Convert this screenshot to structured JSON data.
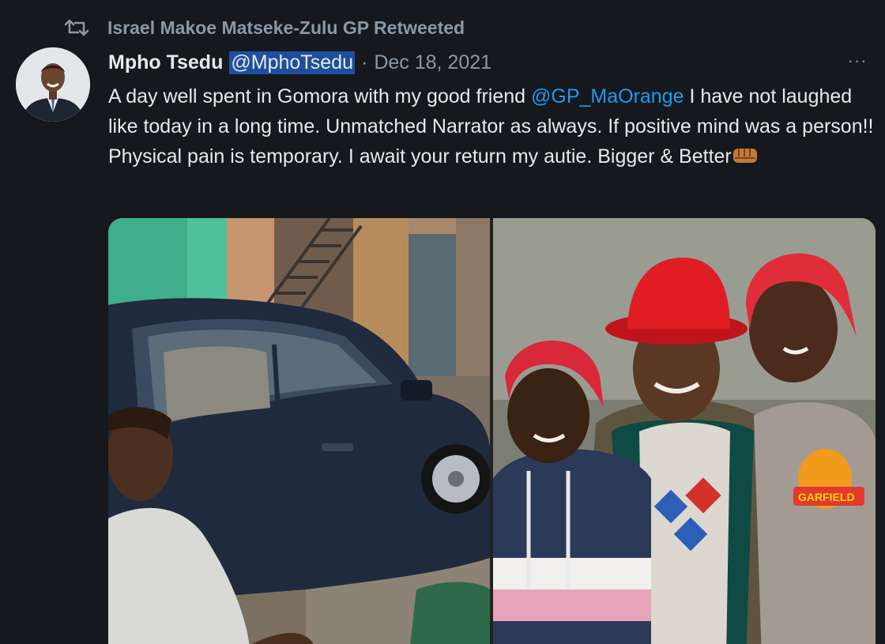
{
  "retweet": {
    "icon": "retweet-icon",
    "label": "Israel Makoe Matseke-Zulu GP Retweeted"
  },
  "author": {
    "name": "Mpho Tsedu",
    "handle": "@MphoTsedu",
    "separator": "·",
    "date": "Dec 18, 2021",
    "avatar_icon": "avatar"
  },
  "more_icon": "more-options-icon",
  "more_label": "···",
  "tweet": {
    "part1": "A day well spent in Gomora with my good friend ",
    "mention": "@GP_MaOrange",
    "part2": " I have not laughed like today in a long time. Unmatched Narrator as always. If positive mind was a person!! Physical pain is temporary. I await your return my autie. Bigger & Better",
    "emoji": "fist-bump-icon"
  },
  "media": {
    "photo1": "man-beside-car-photo",
    "photo2": "family-portrait-photo",
    "shirt_text": "GARFIELD"
  },
  "colors": {
    "background": "#15181c",
    "text": "#e7e9ea",
    "muted": "#8b98a5",
    "link": "#1d9bf0",
    "highlight": "#1d4f9e"
  }
}
